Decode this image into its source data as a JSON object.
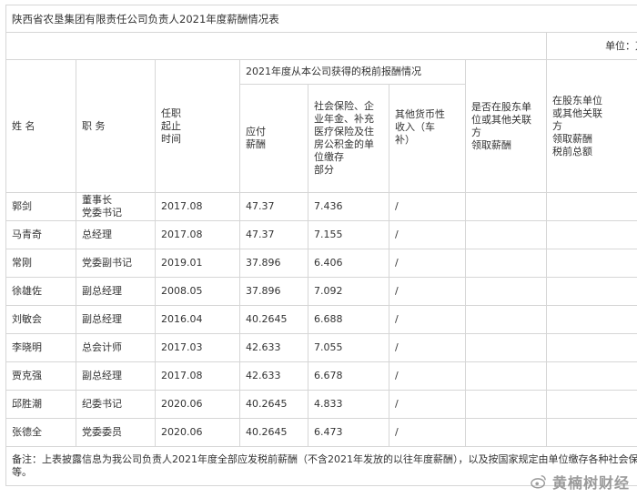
{
  "title": "陕西省农垦集团有限责任公司负责人2021年度薪酬情况表",
  "unit": "单位：万元",
  "headers": {
    "name": "姓 名",
    "position": "职 务",
    "tenure": [
      "任职",
      "起止",
      "时间"
    ],
    "group": "2021年度从本公司获得的税前报酬情况",
    "salary": [
      "应付",
      "薪酬"
    ],
    "social": [
      "社会保险、企",
      "业年金、补充",
      "医疗保险及住",
      "房公积金的单",
      "位缴存",
      "部分"
    ],
    "other": [
      "其他货币性",
      "收入（车",
      "补）"
    ],
    "shareholder": [
      "是否在股东单",
      "位或其他关联",
      "方",
      "领取薪酬"
    ],
    "related": [
      "在股东单位",
      "或其他关联",
      "方",
      "领取薪酬",
      "税前总额"
    ]
  },
  "rows": [
    {
      "name": "郭剑",
      "position": [
        "董事长",
        "党委书记"
      ],
      "tenure": "2017.08",
      "salary": "47.37",
      "social": "7.436",
      "other": "/"
    },
    {
      "name": "马青奇",
      "position": [
        "总经理"
      ],
      "tenure": "2017.08",
      "salary": "47.37",
      "social": "7.155",
      "other": "/"
    },
    {
      "name": "常刚",
      "position": [
        "党委副书记"
      ],
      "tenure": "2019.01",
      "salary": "37.896",
      "social": "6.406",
      "other": "/"
    },
    {
      "name": "徐雄佐",
      "position": [
        "副总经理"
      ],
      "tenure": "2008.05",
      "salary": "37.896",
      "social": "7.092",
      "other": "/"
    },
    {
      "name": "刘敏会",
      "position": [
        "副总经理"
      ],
      "tenure": "2016.04",
      "salary": "40.2645",
      "social": "6.688",
      "other": "/"
    },
    {
      "name": "李晓明",
      "position": [
        "总会计师"
      ],
      "tenure": "2017.03",
      "salary": "42.633",
      "social": "7.055",
      "other": "/"
    },
    {
      "name": "贾克强",
      "position": [
        "副总经理"
      ],
      "tenure": "2017.08",
      "salary": "42.633",
      "social": "6.678",
      "other": "/"
    },
    {
      "name": "邱胜潮",
      "position": [
        "纪委书记"
      ],
      "tenure": "2020.06",
      "salary": "40.2645",
      "social": "4.833",
      "other": "/"
    },
    {
      "name": "张德全",
      "position": [
        "党委委员"
      ],
      "tenure": "2020.06",
      "salary": "40.2645",
      "social": "6.473",
      "other": "/"
    }
  ],
  "note": "备注：上表披露信息为我公司负责人2021年度全部应发税前薪酬（不含2021年发放的以往年度薪酬），以及按国家规定由单位缴存各种社会保险等。",
  "watermark": "黄楠树财经",
  "icons": {
    "watermark": "weibo-icon"
  }
}
